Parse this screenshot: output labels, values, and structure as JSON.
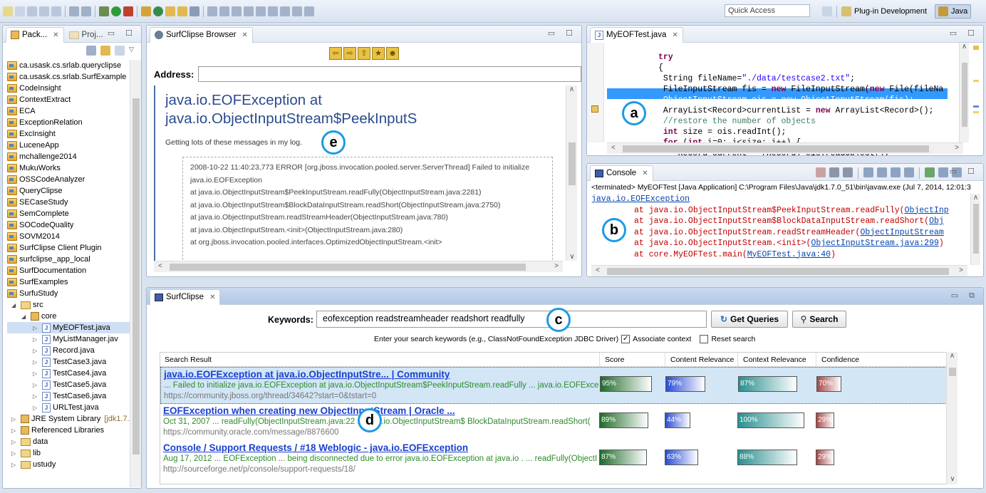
{
  "toolbar": {
    "quick_access": "Quick Access",
    "perspective_plugin": "Plug-in Development",
    "perspective_java": "Java"
  },
  "package_explorer": {
    "tab1": "Pack...",
    "tab2": "Proj...",
    "projects": [
      "ca.usask.cs.srlab.queryclipse",
      "ca.usask.cs.srlab.SurfExample",
      "CodeInsight",
      "ContextExtract",
      "ECA",
      "ExceptionRelation",
      "ExcInsight",
      "LuceneApp",
      "mchallenge2014",
      "MukuWorks",
      "OSSCodeAnalyzer",
      "QueryClipse",
      "SECaseStudy",
      "SemComplete",
      "SOCodeQuality",
      "SOVM2014",
      "SurfClipse Client Plugin",
      "surfclipse_app_local",
      "SurfDocumentation",
      "SurfExamples",
      "SurfuStudy"
    ],
    "src": "src",
    "core": "core",
    "files": [
      "MyEOFTest.java",
      "MyListManager.jav",
      "Record.java",
      "TestCase3.java",
      "TestCase4.java",
      "TestCase5.java",
      "TestCase6.java",
      "URLTest.java"
    ],
    "jre": "JRE System Library",
    "jre_version": "[jdk1.7.",
    "referenced": "Referenced Libraries",
    "folders": [
      "data",
      "lib",
      "ustudy"
    ]
  },
  "browser": {
    "tab": "SurfClipse Browser",
    "address_label": "Address:",
    "address_value": "",
    "heading": "java.io.EOFException at java.io.ObjectInputStream$PeekInputS",
    "intro": "Getting lots of these messages in my log.",
    "log_lines": [
      "2008-10-22 11:40:23,773 ERROR [org.jboss.invocation.pooled.server.ServerThread] Failed to initialize",
      "java.io.EOFException",
      "at java.io.ObjectInputStream$PeekInputStream.readFully(ObjectInputStream.java:2281)",
      "at java.io.ObjectInputStream$BlockDataInputStream.readShort(ObjectInputStream.java:2750)",
      "at java.io.ObjectInputStream.readStreamHeader(ObjectInputStream.java:780)",
      "at java.io.ObjectInputStream.<init>(ObjectInputStream.java:280)",
      "at org.jboss.invocation.pooled.interfaces.OptimizedObjectInputStream.<init>"
    ]
  },
  "editor": {
    "tab": "MyEOFTest.java"
  },
  "console": {
    "tab": "Console",
    "header": "<terminated> MyEOFTest [Java Application] C:\\Program Files\\Java\\jdk1.7.0_51\\bin\\javaw.exe (Jul 7, 2014, 12:01:3",
    "exception": "java.io.EOFException",
    "frames": [
      {
        "text": "at java.io.ObjectInputStream$PeekInputStream.readFully(",
        "link": "ObjectInp"
      },
      {
        "text": "at java.io.ObjectInputStream$BlockDataInputStream.readShort(",
        "link": "Obj"
      },
      {
        "text": "at java.io.ObjectInputStream.readStreamHeader(",
        "link": "ObjectInputStream"
      },
      {
        "text": "at java.io.ObjectInputStream.<init>(",
        "link": "ObjectInputStream.java:299",
        "tail": ")"
      },
      {
        "text": "at core.MyEOFTest.main(",
        "link": "MyEOFTest.java:40",
        "tail": ")"
      }
    ]
  },
  "surfclipse": {
    "tab": "SurfClipse",
    "keywords_label": "Keywords:",
    "keywords_value": "eofexception readstreamheader readshort readfully",
    "get_queries": "Get Queries",
    "search": "Search",
    "hint": "Enter your search keywords (e.g., ClassNotFoundException JDBC Driver)",
    "assoc_context": "Associate context",
    "reset_search": "Reset search",
    "columns": [
      "Search Result",
      "Score",
      "Content Relevance",
      "Context Relevance",
      "Confidence"
    ],
    "results": [
      {
        "title": "java.io.EOFException at java.io.ObjectInputStre... | Community",
        "snippet": "... Failed to initialize java.io.EOFException at java.io.ObjectInputStream$PeekInputStream.readFully ... java.io.EOFExce",
        "url": "https://community.jboss.org/thread/34642?start=0&tstart=0",
        "score": "95%",
        "content": "79%",
        "context": "87%",
        "confidence": "70%"
      },
      {
        "title": "EOFException when creating new ObjectInputStream | Oracle ...",
        "snippet": "Oct 31, 2007 ... readFully(ObjectInputStream.java:22 ... java.io.ObjectInputStream$ BlockDataInputStream.readShort(",
        "url": "https://community.oracle.com/message/8876600",
        "score": "89%",
        "content": "44%",
        "context": "100%",
        "confidence": "29%"
      },
      {
        "title": "Console / Support Requests / #18 Weblogic - java.io.EOFException",
        "snippet": "Aug 17, 2012 ... EOFException ... being disconnected due to error java.io.EOFException at java.io . ... readFully(ObjectI",
        "url": "http://sourceforge.net/p/console/support-requests/18/",
        "score": "87%",
        "content": "63%",
        "context": "88%",
        "confidence": "29%"
      }
    ]
  },
  "badges": {
    "a": "a",
    "b": "b",
    "c": "c",
    "d": "d",
    "e": "e"
  }
}
